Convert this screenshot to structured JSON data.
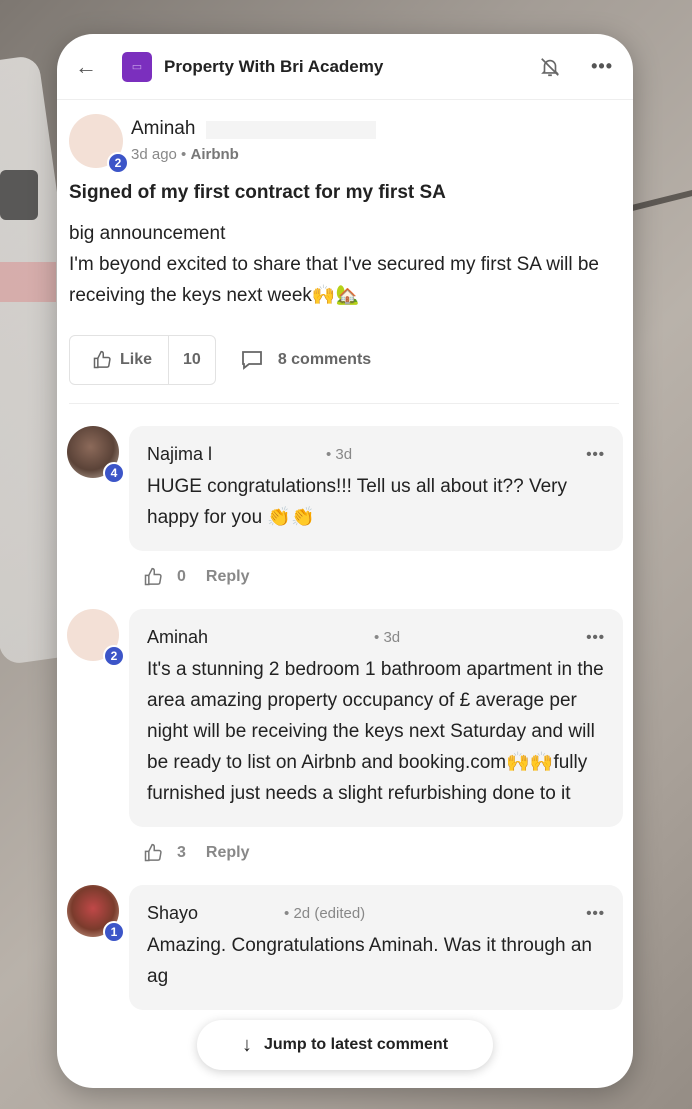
{
  "header": {
    "title": "Property With Bri Academy"
  },
  "post": {
    "author": "Aminah",
    "badge": "2",
    "time": "3d ago",
    "separator": " • ",
    "category": "Airbnb",
    "title": "Signed of my first contract for my first SA",
    "body_line1": "big announcement",
    "body_line2": "I'm beyond excited to share that I've secured my first SA will be receiving the keys next week",
    "body_emoji": "🙌🏡",
    "like_label": "Like",
    "like_count": "10",
    "comments_label": "8 comments"
  },
  "comments": [
    {
      "author": "Najima l",
      "time": "• 3d",
      "badge": "4",
      "text": "HUGE congratulations!!! Tell us all about it?? Very happy for you",
      "emoji": "👏👏",
      "likes": "0",
      "reply": "Reply"
    },
    {
      "author": "Aminah",
      "time": "• 3d",
      "badge": "2",
      "text": "It's a stunning 2 bedroom 1 bathroom apartment in the       area amazing property occupancy of £         average per night will be receiving the keys next Saturday and will be ready to list on Airbnb and booking.com",
      "emoji": "🙌🙌",
      "text2": "fully furnished just needs a slight refurbishing done to it",
      "likes": "3",
      "reply": "Reply"
    },
    {
      "author": "Shayo",
      "time": "• 2d (edited)",
      "badge": "1",
      "text": "Amazing. Congratulations Aminah. Was it through an ag"
    }
  ],
  "jump_label": "Jump to latest comment",
  "icons": {
    "back": "arrow-left-icon",
    "bell": "bell-off-icon",
    "more": "more-horizontal-icon",
    "thumb": "thumbs-up-icon",
    "comment": "comment-bubble-icon",
    "jump": "arrow-down-icon"
  },
  "colors": {
    "badge": "#3c55c8",
    "group_logo": "#7b2fbe"
  }
}
